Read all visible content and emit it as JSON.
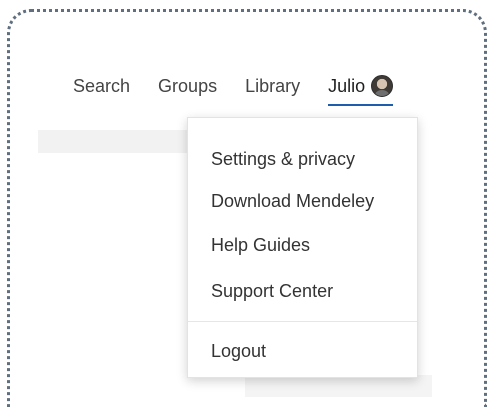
{
  "nav": {
    "items": [
      "Search",
      "Groups",
      "Library"
    ],
    "user_name": "Julio"
  },
  "menu": {
    "items": [
      "Settings & privacy",
      "Download Mendeley",
      "Help Guides",
      "Support Center"
    ],
    "logout_label": "Logout"
  },
  "colors": {
    "accent": "#1d5dab",
    "text": "#333333",
    "frame_border": "#5f6f7f"
  }
}
